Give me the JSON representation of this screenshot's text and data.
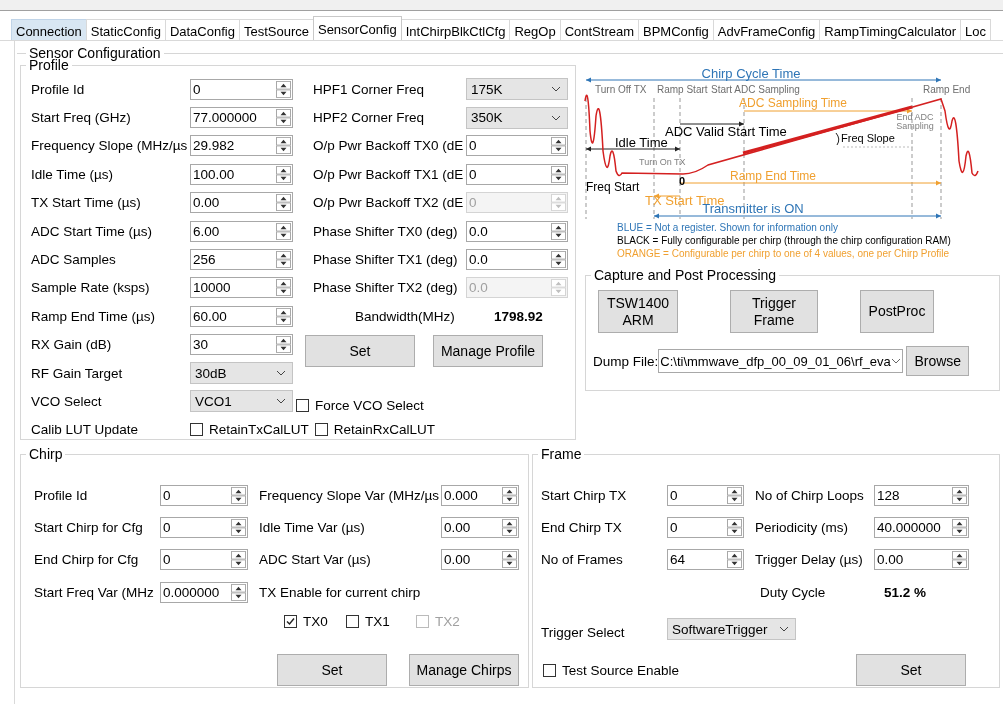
{
  "tabs": [
    {
      "label": "Connection",
      "selected": false,
      "hovered": true
    },
    {
      "label": "StaticConfig",
      "selected": false,
      "hovered": false
    },
    {
      "label": "DataConfig",
      "selected": false,
      "hovered": false
    },
    {
      "label": "TestSource",
      "selected": false,
      "hovered": false
    },
    {
      "label": "SensorConfig",
      "selected": true,
      "hovered": false
    },
    {
      "label": "IntChirpBlkCtlCfg",
      "selected": false,
      "hovered": false
    },
    {
      "label": "RegOp",
      "selected": false,
      "hovered": false
    },
    {
      "label": "ContStream",
      "selected": false,
      "hovered": false
    },
    {
      "label": "BPMConfig",
      "selected": false,
      "hovered": false
    },
    {
      "label": "AdvFrameConfig",
      "selected": false,
      "hovered": false
    },
    {
      "label": "RampTimingCalculator",
      "selected": false,
      "hovered": false
    },
    {
      "label": "Loc",
      "selected": false,
      "hovered": false
    }
  ],
  "sensor_config": {
    "title": "Sensor Configuration",
    "profile": {
      "title": "Profile",
      "left_fields": [
        {
          "label": "Profile Id",
          "value": "0",
          "kind": "spin",
          "disabled": false
        },
        {
          "label": "Start Freq (GHz)",
          "value": "77.000000",
          "kind": "spin",
          "disabled": false
        },
        {
          "label": "Frequency Slope (MHz/µs",
          "value": "29.982",
          "kind": "spin",
          "disabled": false
        },
        {
          "label": "Idle Time (µs)",
          "value": "100.00",
          "kind": "spin",
          "disabled": false
        },
        {
          "label": "TX Start Time (µs)",
          "value": "0.00",
          "kind": "spin",
          "disabled": false
        },
        {
          "label": "ADC Start Time (µs)",
          "value": "6.00",
          "kind": "spin",
          "disabled": false
        },
        {
          "label": "ADC Samples",
          "value": "256",
          "kind": "spin",
          "disabled": false
        },
        {
          "label": "Sample Rate (ksps)",
          "value": "10000",
          "kind": "spin",
          "disabled": false
        },
        {
          "label": "Ramp End Time (µs)",
          "value": "60.00",
          "kind": "spin",
          "disabled": false
        },
        {
          "label": "RX Gain (dB)",
          "value": "30",
          "kind": "spin",
          "disabled": false
        },
        {
          "label": "RF Gain Target",
          "value": "30dB",
          "kind": "select",
          "disabled": false
        },
        {
          "label": "VCO Select",
          "value": "VCO1",
          "kind": "select",
          "disabled": false
        }
      ],
      "right_fields": [
        {
          "label": "HPF1 Corner Freq",
          "value": "175K",
          "kind": "select",
          "disabled": false
        },
        {
          "label": "HPF2 Corner Freq",
          "value": "350K",
          "kind": "select",
          "disabled": false
        },
        {
          "label": "O/p Pwr Backoff TX0 (dE",
          "value": "0",
          "kind": "spin",
          "disabled": false
        },
        {
          "label": "O/p Pwr Backoff TX1 (dE",
          "value": "0",
          "kind": "spin",
          "disabled": false
        },
        {
          "label": "O/p Pwr Backoff TX2 (dE",
          "value": "0",
          "kind": "spin",
          "disabled": true
        },
        {
          "label": "Phase Shifter TX0 (deg)",
          "value": "0.0",
          "kind": "spin",
          "disabled": false
        },
        {
          "label": "Phase Shifter TX1 (deg)",
          "value": "0.0",
          "kind": "spin",
          "disabled": false
        },
        {
          "label": "Phase Shifter TX2 (deg)",
          "value": "0.0",
          "kind": "spin",
          "disabled": true
        }
      ],
      "bandwidth_label": "Bandwidth(MHz)",
      "bandwidth_value": "1798.92",
      "buttons": [
        "Set",
        "Manage Profile"
      ],
      "force_vco": {
        "label": "Force VCO Select",
        "checked": false
      },
      "calib_label": "Calib LUT Update",
      "calib_options": [
        {
          "label": "RetainTxCalLUT",
          "checked": false
        },
        {
          "label": "RetainRxCalLUT",
          "checked": false
        }
      ]
    },
    "diagram": {
      "labels": [
        {
          "text": "Chirp Cycle Time",
          "color": "#2e75b6"
        },
        {
          "text": "Turn Off TX",
          "color": "#6e6e6e"
        },
        {
          "text": "Ramp Start",
          "color": "#6e6e6e"
        },
        {
          "text": "Start ADC Sampling",
          "color": "#6e6e6e"
        },
        {
          "text": "Ramp End",
          "color": "#6e6e6e"
        },
        {
          "text": "ADC Sampling Time",
          "color": "#f0a030"
        },
        {
          "text": "ADC Valid Start Time",
          "color": "#000000"
        },
        {
          "text": "Idle Time",
          "color": "#000000"
        },
        {
          "text": "Freq Slope",
          "color": "#000000"
        },
        {
          "text": "End ADC Sampling",
          "color": "#808080"
        },
        {
          "text": "Turn On TX",
          "color": "#808080"
        },
        {
          "text": "0",
          "color": "#000000"
        },
        {
          "text": "Ramp End Time",
          "color": "#f0a030"
        },
        {
          "text": "Freq Start",
          "color": "#000000"
        },
        {
          "text": "TX Start Time",
          "color": "#f0a030"
        },
        {
          "text": "Transmitter is ON",
          "color": "#2e75b6"
        },
        {
          "text": "BLUE = Not a register. Shown for information only",
          "color": "#2e75b6"
        },
        {
          "text": "BLACK = Fully configurable per chirp (through the chirp configuration RAM)",
          "color": "#000000"
        },
        {
          "text": "ORANGE = Configurable per chirp to one of 4 values, one per Chirp Profile",
          "color": "#f0a030"
        }
      ]
    },
    "capture": {
      "title": "Capture and Post Processing",
      "buttons": [
        "TSW1400 ARM",
        "Trigger Frame",
        "PostProc"
      ],
      "dump_label": "Dump File:",
      "dump_value": "C:\\ti\\mmwave_dfp_00_09_01_06\\rf_eva",
      "browse": "Browse"
    },
    "chirp": {
      "title": "Chirp",
      "left_fields": [
        {
          "label": "Profile Id",
          "value": "0"
        },
        {
          "label": "Start Chirp for Cfg",
          "value": "0"
        },
        {
          "label": "End Chirp for Cfg",
          "value": "0"
        },
        {
          "label": "Start Freq Var (MHz",
          "value": "0.000000"
        }
      ],
      "right_fields": [
        {
          "label": "Frequency Slope Var (MHz/µs",
          "value": "0.000"
        },
        {
          "label": "Idle Time Var (µs)",
          "value": "0.00"
        },
        {
          "label": "ADC Start Var (µs)",
          "value": "0.00"
        }
      ],
      "tx_label": "TX Enable for current chirp",
      "tx_options": [
        {
          "label": "TX0",
          "checked": true,
          "disabled": false
        },
        {
          "label": "TX1",
          "checked": false,
          "disabled": false
        },
        {
          "label": "TX2",
          "checked": false,
          "disabled": true
        }
      ],
      "buttons": [
        "Set",
        "Manage Chirps"
      ]
    },
    "frame": {
      "title": "Frame",
      "left_fields": [
        {
          "label": "Start Chirp TX",
          "value": "0"
        },
        {
          "label": "End Chirp TX",
          "value": "0"
        },
        {
          "label": "No of Frames",
          "value": "64"
        }
      ],
      "right_fields": [
        {
          "label": "No of Chirp Loops",
          "value": "128"
        },
        {
          "label": "Periodicity (ms)",
          "value": "40.000000"
        },
        {
          "label": "Trigger Delay (µs)",
          "value": "0.00"
        }
      ],
      "duty_label": "Duty Cycle",
      "duty_value": "51.2 %",
      "trigger_label": "Trigger Select",
      "trigger_value": "SoftwareTrigger",
      "test_source": {
        "label": "Test Source Enable",
        "checked": false
      },
      "button": "Set"
    }
  }
}
